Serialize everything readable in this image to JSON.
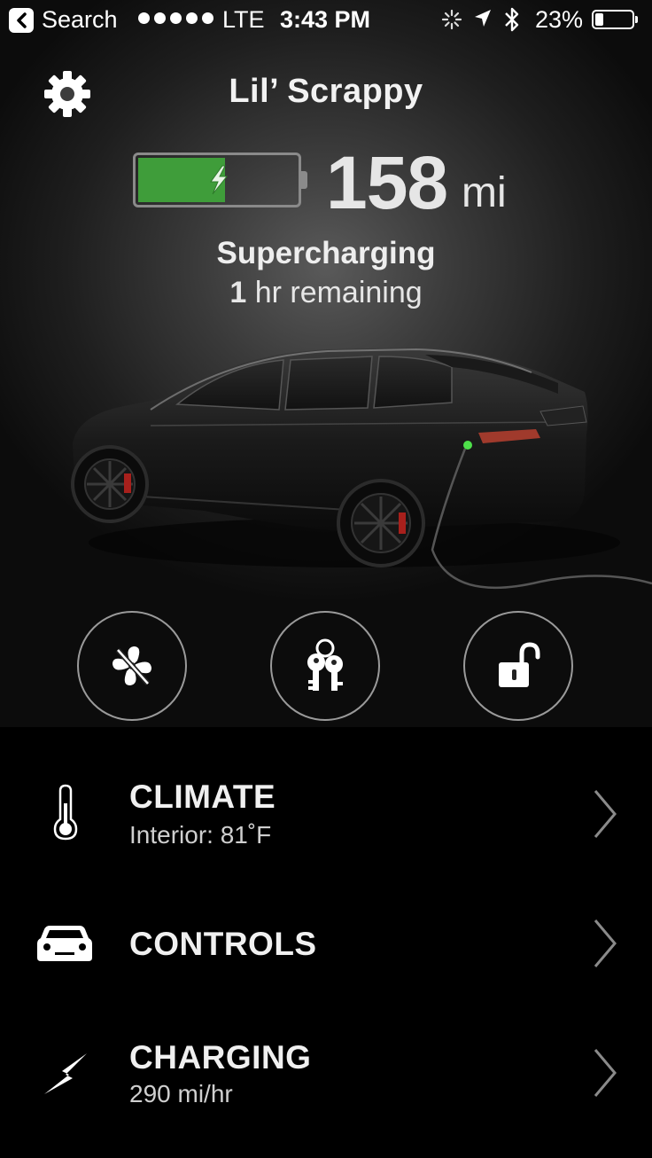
{
  "status_bar": {
    "back_app": "Search",
    "carrier": "LTE",
    "time": "3:43 PM",
    "battery_percent": "23%",
    "battery_level": 0.23,
    "signal_bars": 5
  },
  "header": {
    "car_name": "Lil’ Scrappy",
    "settings_icon": "gear-icon"
  },
  "battery": {
    "range_value": "158",
    "range_unit": "mi",
    "charge_level": 0.55,
    "fill_color": "#3f9d3a",
    "status": "Supercharging",
    "remaining_value": "1",
    "remaining_text": "hr remaining"
  },
  "quick_actions": [
    {
      "name": "fan-off-icon"
    },
    {
      "name": "keys-icon"
    },
    {
      "name": "unlock-icon"
    }
  ],
  "menu": {
    "climate": {
      "title": "CLIMATE",
      "subtitle": "Interior: 81˚F",
      "icon": "thermometer-icon"
    },
    "controls": {
      "title": "CONTROLS",
      "icon": "car-icon"
    },
    "charging": {
      "title": "CHARGING",
      "subtitle": "290 mi/hr",
      "icon": "lightning-icon"
    }
  }
}
